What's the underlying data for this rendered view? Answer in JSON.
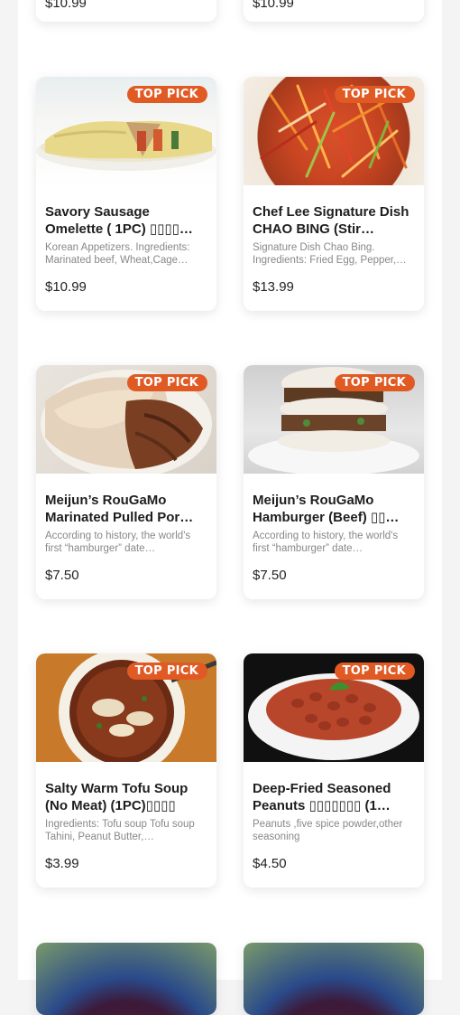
{
  "badge_label": "TOP PICK",
  "top_partial": [
    {
      "price": "$10.99"
    },
    {
      "price": "$10.99"
    }
  ],
  "items": [
    {
      "title": "Savory Sausage Omelette ( 1PC) ▯▯▯▯…",
      "desc": "Korean Appetizers. Ingredients: Marinated beef, Wheat,Cage…",
      "price": "$10.99"
    },
    {
      "title": "Chef Lee Signature Dish CHAO BING (Stir…",
      "desc": "Signature Dish Chao Bing. Ingredients: Fried Egg, Pepper,…",
      "price": "$13.99"
    },
    {
      "title": "Meijun’s RouGaMo Marinated Pulled Por…",
      "desc": "According to history, the world's first “hamburger” date…",
      "price": "$7.50"
    },
    {
      "title": "Meijun’s RouGaMo Hamburger (Beef) ▯▯…",
      "desc": "According to history, the world's first “hamburger” date…",
      "price": "$7.50"
    },
    {
      "title": "Salty Warm Tofu Soup (No Meat) (1PC)▯▯▯▯",
      "desc": "Ingredients: Tofu soup Tofu soup Tahini, Peanut Butter,…",
      "price": "$3.99"
    },
    {
      "title": "Deep-Fried Seasoned Peanuts ▯▯▯▯▯▯▯ (1…",
      "desc": "Peanuts ,five spice powder,other seasoning",
      "price": "$4.50"
    }
  ],
  "colors": {
    "badge": "#e15a24",
    "background": "#f4f4f4",
    "card": "#ffffff"
  }
}
